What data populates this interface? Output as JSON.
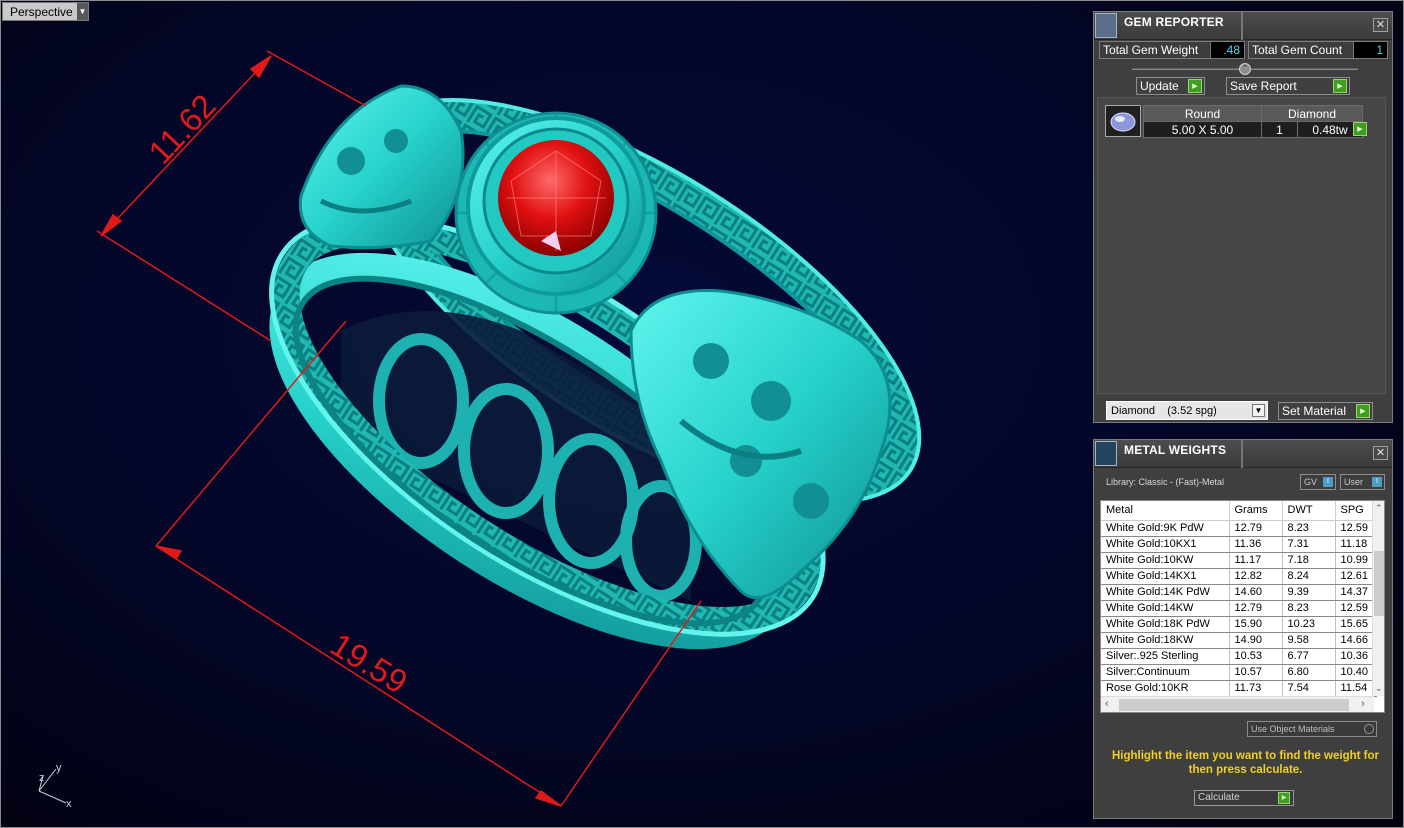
{
  "viewport": {
    "tab_label": "Perspective",
    "tab_dropdown_icon": "triangle-down-icon"
  },
  "dimensions": {
    "top": "11.62",
    "bottom": "19.59"
  },
  "axis": {
    "x": "x",
    "y": "y",
    "z": "z"
  },
  "gem_reporter": {
    "title": "GEM REPORTER",
    "total_weight_label": "Total Gem Weight",
    "total_weight_value": ".48",
    "total_count_label": "Total Gem Count",
    "total_count_value": "1",
    "update_label": "Update",
    "save_report_label": "Save Report",
    "table": {
      "shape": "Round",
      "material": "Diamond",
      "size": "5.00 X 5.00",
      "count": "1",
      "weight": "0.48tw"
    },
    "material_select": "Diamond    (3.52 spg)",
    "set_material_label": "Set Material"
  },
  "metal_weights": {
    "title": "METAL WEIGHTS",
    "library": "Library: Classic - (Fast)-Metal",
    "gv_label": "GV",
    "user_label": "User",
    "columns": [
      "Metal",
      "Grams",
      "DWT",
      "SPG"
    ],
    "rows": [
      [
        "White Gold:9K PdW",
        "12.79",
        "8.23",
        "12.59"
      ],
      [
        "White Gold:10KX1",
        "11.36",
        "7.31",
        "11.18"
      ],
      [
        "White Gold:10KW",
        "11.17",
        "7.18",
        "10.99"
      ],
      [
        "White Gold:14KX1",
        "12.82",
        "8.24",
        "12.61"
      ],
      [
        "White Gold:14K PdW",
        "14.60",
        "9.39",
        "14.37"
      ],
      [
        "White Gold:14KW",
        "12.79",
        "8.23",
        "12.59"
      ],
      [
        "White Gold:18K PdW",
        "15.90",
        "10.23",
        "15.65"
      ],
      [
        "White Gold:18KW",
        "14.90",
        "9.58",
        "14.66"
      ],
      [
        "Silver:.925 Sterling",
        "10.53",
        "6.77",
        "10.36"
      ],
      [
        "Silver:Continuum",
        "10.57",
        "6.80",
        "10.40"
      ],
      [
        "Rose Gold:10KR",
        "11.73",
        "7.54",
        "11.54"
      ]
    ],
    "use_object_materials": "Use Object Materials",
    "hint": "Highlight the item you want to find the weight for then press calculate.",
    "calculate_label": "Calculate"
  },
  "colors": {
    "ring": "#2fe0d8",
    "dimension": "#e01a1a",
    "hint": "#f0d020",
    "value_text": "#4fd8e8"
  }
}
